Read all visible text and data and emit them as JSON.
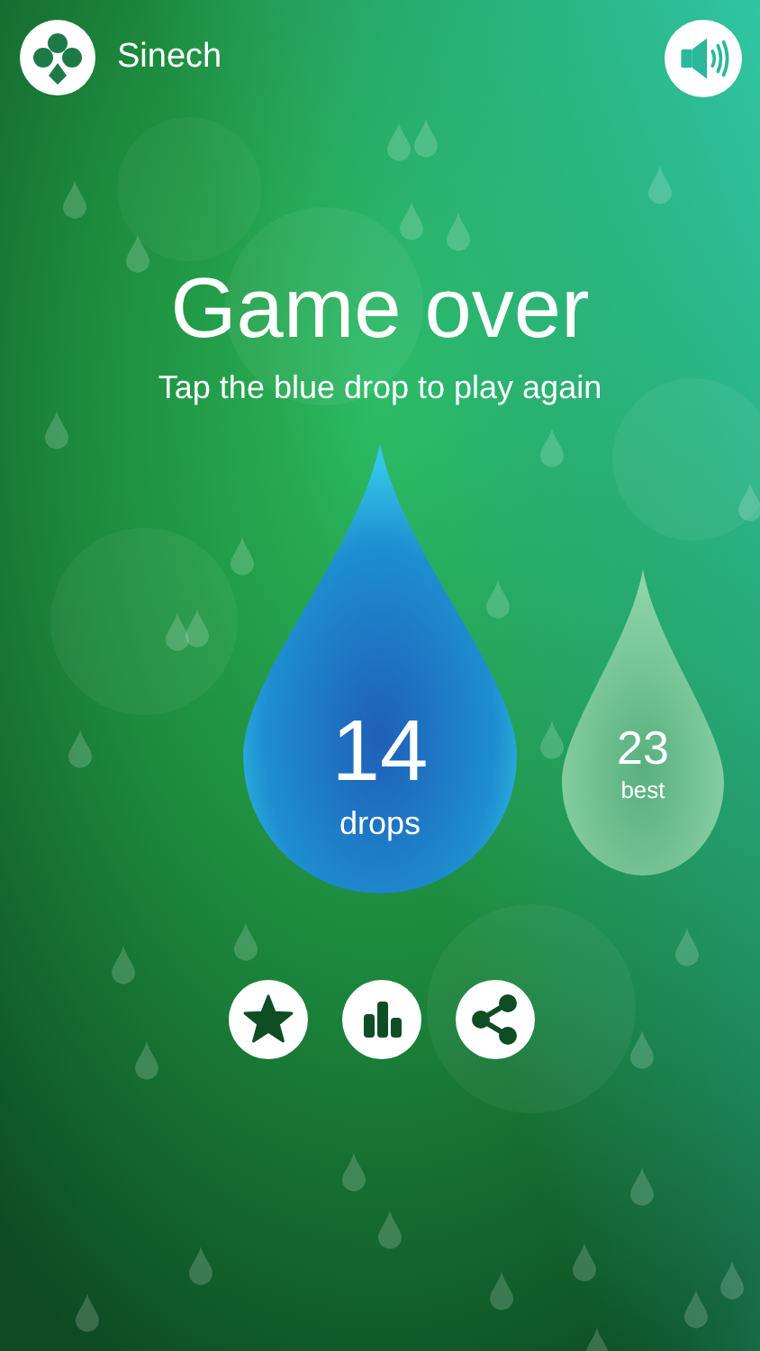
{
  "header": {
    "app_name": "Sinech"
  },
  "title": "Game over",
  "subtitle": "Tap the blue drop to play again",
  "score": {
    "value": "14",
    "label": "drops"
  },
  "best": {
    "value": "23",
    "label": "best"
  }
}
